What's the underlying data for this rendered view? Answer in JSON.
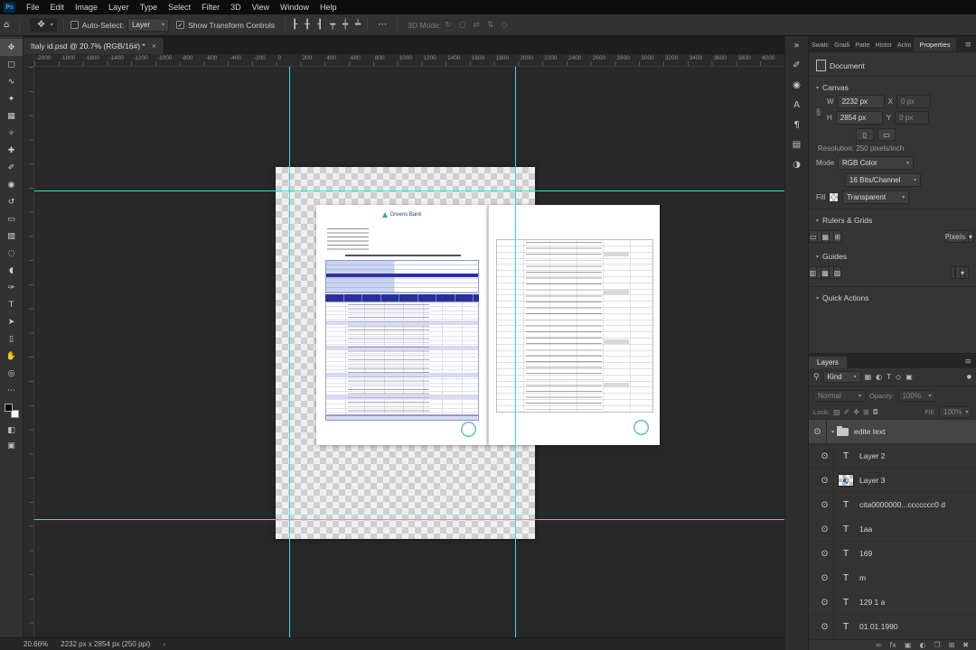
{
  "colors": {
    "accent_blue": "#31a8ff",
    "guide_cyan": "#2be3da",
    "table_header_purple": "#2b2f9e",
    "stamp_teal": "#35b0a8"
  },
  "icons": {
    "home": "⌂",
    "chevron": "▾",
    "close": "×",
    "ellipsis": "⋯",
    "menu": "≡",
    "collapse": "»",
    "search": "⚲",
    "eye": "ʘ",
    "link": "§",
    "move": "✥",
    "check": "✓",
    "dot": "●"
  },
  "menubar": {
    "logo": "Ps",
    "items": [
      {
        "name": "menu-file",
        "label": "File"
      },
      {
        "name": "menu-edit",
        "label": "Edit"
      },
      {
        "name": "menu-image",
        "label": "Image"
      },
      {
        "name": "menu-layer",
        "label": "Layer"
      },
      {
        "name": "menu-type",
        "label": "Type"
      },
      {
        "name": "menu-select",
        "label": "Select"
      },
      {
        "name": "menu-filter",
        "label": "Filter"
      },
      {
        "name": "menu-3d",
        "label": "3D"
      },
      {
        "name": "menu-view",
        "label": "View"
      },
      {
        "name": "menu-window",
        "label": "Window"
      },
      {
        "name": "menu-help",
        "label": "Help"
      }
    ]
  },
  "options_bar": {
    "auto_select_label": "Auto-Select:",
    "auto_select_value": "Layer",
    "show_transform_label": "Show Transform Controls",
    "mode_3d_label": "3D Mode:",
    "align_icons": [
      {
        "name": "align-left-icon",
        "glyph": "┠"
      },
      {
        "name": "align-center-h-icon",
        "glyph": "╂"
      },
      {
        "name": "align-right-icon",
        "glyph": "┨"
      },
      {
        "name": "align-top-icon",
        "glyph": "┯"
      },
      {
        "name": "align-middle-icon",
        "glyph": "┿"
      },
      {
        "name": "align-bottom-icon",
        "glyph": "┷"
      }
    ],
    "mode_3d_icons": [
      {
        "name": "3d-rotate-icon",
        "glyph": "↻"
      },
      {
        "name": "3d-roll-icon",
        "glyph": "○"
      },
      {
        "name": "3d-drag-icon",
        "glyph": "⇄"
      },
      {
        "name": "3d-slide-icon",
        "glyph": "⇅"
      },
      {
        "name": "3d-scale-icon",
        "glyph": "◇"
      }
    ]
  },
  "toolbar": {
    "tools": [
      {
        "name": "move-tool",
        "glyph": "✥"
      },
      {
        "name": "marquee-tool",
        "glyph": "▢"
      },
      {
        "name": "lasso-tool",
        "glyph": "∿"
      },
      {
        "name": "quick-selection-tool",
        "glyph": "✦"
      },
      {
        "name": "crop-tool",
        "glyph": "▦"
      },
      {
        "name": "eyedropper-tool",
        "glyph": "✧"
      },
      {
        "name": "healing-brush-tool",
        "glyph": "✚"
      },
      {
        "name": "brush-tool",
        "glyph": "✐"
      },
      {
        "name": "clone-stamp-tool",
        "glyph": "◉"
      },
      {
        "name": "history-brush-tool",
        "glyph": "↺"
      },
      {
        "name": "eraser-tool",
        "glyph": "▭"
      },
      {
        "name": "gradient-tool",
        "glyph": "▨"
      },
      {
        "name": "blur-tool",
        "glyph": "◌"
      },
      {
        "name": "dodge-tool",
        "glyph": "◖"
      },
      {
        "name": "pen-tool",
        "glyph": "✑"
      },
      {
        "name": "type-tool",
        "glyph": "T"
      },
      {
        "name": "path-select-tool",
        "glyph": "➤"
      },
      {
        "name": "shape-tool",
        "glyph": "▯"
      },
      {
        "name": "hand-tool",
        "glyph": "✋"
      },
      {
        "name": "zoom-tool",
        "glyph": "◎"
      },
      {
        "name": "edit-toolbar-icon",
        "glyph": "⋯"
      }
    ],
    "extras": [
      {
        "name": "quick-mask-icon",
        "glyph": "◧"
      },
      {
        "name": "screen-mode-icon",
        "glyph": "▣"
      }
    ]
  },
  "document_tab": {
    "title": "Italy id.psd @ 20.7% (RGB/16#) *"
  },
  "ruler": {
    "labels": [
      "-2000",
      "-1800",
      "-1600",
      "-1400",
      "-1200",
      "-1000",
      "-800",
      "-600",
      "-400",
      "-200",
      "0",
      "200",
      "400",
      "600",
      "800",
      "1000",
      "1200",
      "1400",
      "1600",
      "1800",
      "2000",
      "2200",
      "2400",
      "2600",
      "2800",
      "3000",
      "3200",
      "3400",
      "3600",
      "3800",
      "4000"
    ]
  },
  "canvas": {
    "bank_name": "Greens Bank"
  },
  "collapsed_panels": {
    "icons": [
      {
        "name": "expand-panels-icon",
        "glyph": "»"
      },
      {
        "name": "brushes-panel-icon",
        "glyph": "✐"
      },
      {
        "name": "clone-source-panel-icon",
        "glyph": "◉"
      },
      {
        "name": "character-panel-icon",
        "glyph": "A"
      },
      {
        "name": "paragraph-panel-icon",
        "glyph": "¶"
      },
      {
        "name": "libraries-panel-icon",
        "glyph": "▤"
      },
      {
        "name": "adjustments-panel-icon",
        "glyph": "◑"
      }
    ]
  },
  "properties_panel": {
    "tabs": [
      "Swatc",
      "Gradi",
      "Patte",
      "Histor",
      "Actio"
    ],
    "active_tab": "Properties",
    "document_label": "Document",
    "canvas_section": "Canvas",
    "w_label": "W",
    "w_value": "2232 px",
    "x_label": "X",
    "x_value": "0 px",
    "h_label": "H",
    "h_value": "2854 px",
    "y_label": "Y",
    "y_value": "0 px",
    "orientation_icons": [
      {
        "name": "portrait-icon",
        "glyph": "▯"
      },
      {
        "name": "landscape-icon",
        "glyph": "▭"
      }
    ],
    "resolution_text": "Resolution: 250 pixels/inch",
    "mode_label": "Mode",
    "mode_value": "RGB Color",
    "depth_value": "16 Bits/Channel",
    "fill_label": "Fill",
    "fill_value": "Transparent",
    "rulers_section": "Rulers & Grids",
    "rulers_icons": [
      {
        "name": "ruler-toggle-icon",
        "glyph": "▭"
      },
      {
        "name": "grid-toggle-icon",
        "glyph": "▦"
      },
      {
        "name": "snap-toggle-icon",
        "glyph": "⊞"
      }
    ],
    "units_value": "Pixels",
    "guides_section": "Guides",
    "guides_icons": [
      {
        "name": "add-guide-icon",
        "glyph": "▥"
      },
      {
        "name": "guide-layout-icon",
        "glyph": "▦"
      },
      {
        "name": "lock-guides-icon",
        "glyph": "▧"
      }
    ],
    "quick_actions_section": "Quick Actions"
  },
  "layers_panel": {
    "title": "Layers",
    "kind_label": "Kind",
    "filter_icons": [
      {
        "name": "filter-pixel-icon",
        "glyph": "▦"
      },
      {
        "name": "filter-adjustment-icon",
        "glyph": "◐"
      },
      {
        "name": "filter-type-icon",
        "glyph": "T"
      },
      {
        "name": "filter-shape-icon",
        "glyph": "◇"
      },
      {
        "name": "filter-smart-icon",
        "glyph": "▣"
      },
      {
        "name": "filter-toggle",
        "glyph": "●"
      }
    ],
    "blend_mode": "Normal",
    "opacity_label": "Opacity:",
    "opacity_value": "100%",
    "lock_label": "Lock:",
    "lock_icons": [
      {
        "name": "lock-transparency-icon",
        "glyph": "▨"
      },
      {
        "name": "lock-pixels-icon",
        "glyph": "✐"
      },
      {
        "name": "lock-position-icon",
        "glyph": "✥"
      },
      {
        "name": "lock-artboard-icon",
        "glyph": "⊞"
      },
      {
        "name": "lock-all-icon",
        "glyph": "◘"
      }
    ],
    "fill_label": "Fill:",
    "fill_value": "100%",
    "items": [
      {
        "name": "edite text",
        "type": "group"
      },
      {
        "name": "Layer 2",
        "type": "text"
      },
      {
        "name": "Layer 3",
        "type": "image"
      },
      {
        "name": "cita0000000...ccccccc0 d",
        "type": "text"
      },
      {
        "name": "1aa",
        "type": "text"
      },
      {
        "name": "169",
        "type": "text"
      },
      {
        "name": "m",
        "type": "text"
      },
      {
        "name": "129 1 a",
        "type": "text"
      },
      {
        "name": "01.01.1990",
        "type": "text"
      }
    ],
    "bottom_icons": [
      {
        "name": "link-layers-icon",
        "glyph": "∞"
      },
      {
        "name": "layer-effects-icon",
        "glyph": "fx"
      },
      {
        "name": "layer-mask-icon",
        "glyph": "▣"
      },
      {
        "name": "adjustment-layer-icon",
        "glyph": "◐"
      },
      {
        "name": "layer-group-icon",
        "glyph": "❐"
      },
      {
        "name": "new-layer-icon",
        "glyph": "⊞"
      },
      {
        "name": "delete-layer-icon",
        "glyph": "✖"
      }
    ]
  },
  "status_bar": {
    "zoom": "20.66%",
    "doc_info": "2232 px x 2854 px (250 ppi)",
    "chevron": "›"
  }
}
